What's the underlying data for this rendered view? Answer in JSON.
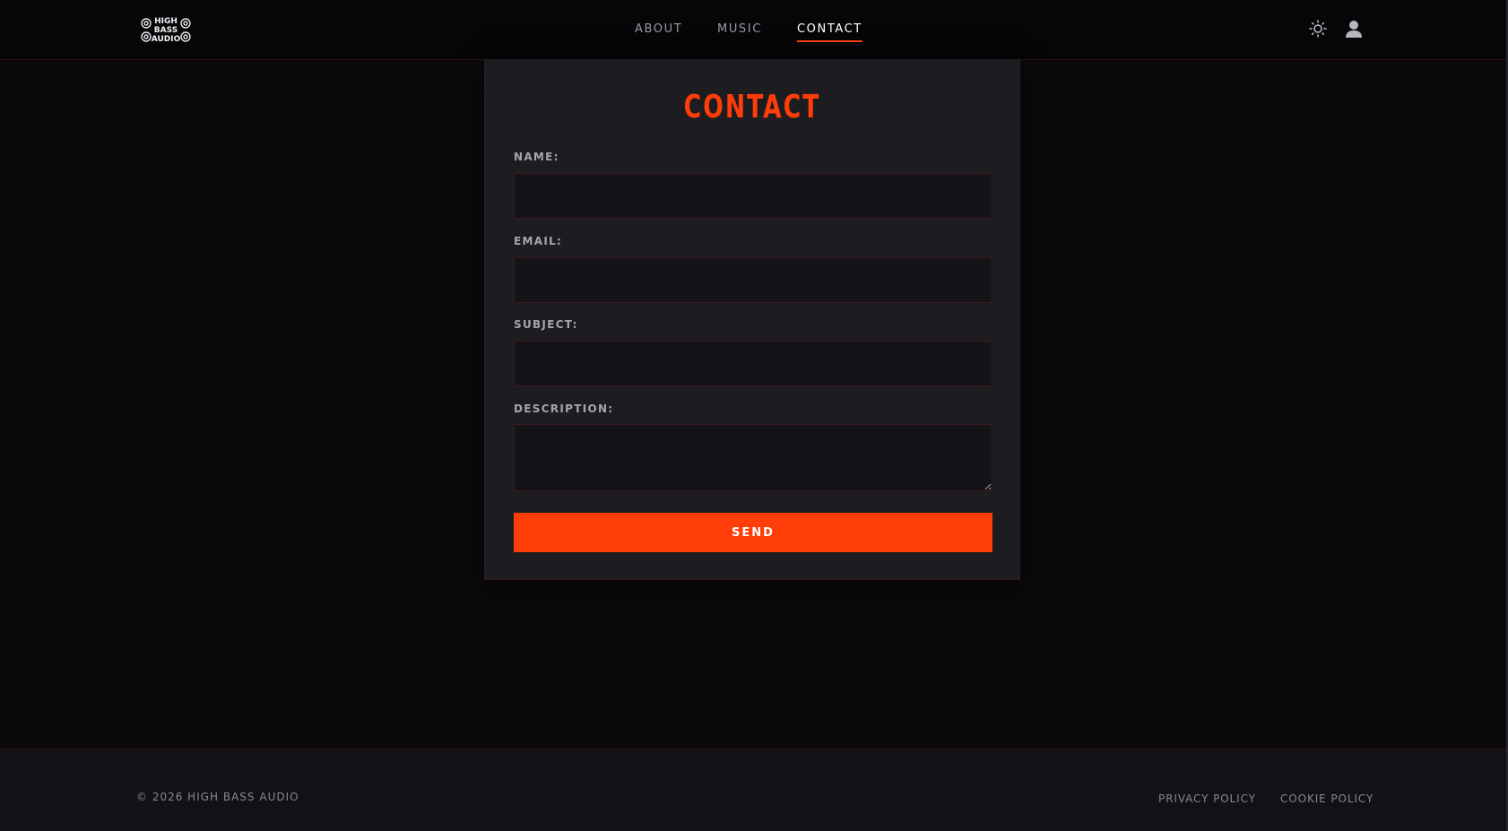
{
  "brand": {
    "logo_text_line1": "HIGH",
    "logo_text_line2": "BASS",
    "logo_text_line3": "AUDIO"
  },
  "nav": {
    "items": [
      {
        "label": "ABOUT",
        "active": false
      },
      {
        "label": "MUSIC",
        "active": false
      },
      {
        "label": "CONTACT",
        "active": true
      }
    ]
  },
  "header_icons": {
    "theme_toggle": "sun-icon",
    "account": "user-icon"
  },
  "contact": {
    "title": "CONTACT",
    "fields": {
      "name": {
        "label": "NAME:",
        "value": ""
      },
      "email": {
        "label": "EMAIL:",
        "value": ""
      },
      "subject": {
        "label": "SUBJECT:",
        "value": ""
      },
      "description": {
        "label": "DESCRIPTION:",
        "value": ""
      }
    },
    "send_label": "SEND"
  },
  "footer": {
    "copyright": "© 2026 HIGH BASS AUDIO",
    "links": [
      "PRIVACY POLICY",
      "COOKIE POLICY"
    ]
  },
  "colors": {
    "accent": "#ff3d08",
    "background": "#0a090c",
    "card": "#1d1c20",
    "input": "#141317",
    "footer": "#121116"
  }
}
